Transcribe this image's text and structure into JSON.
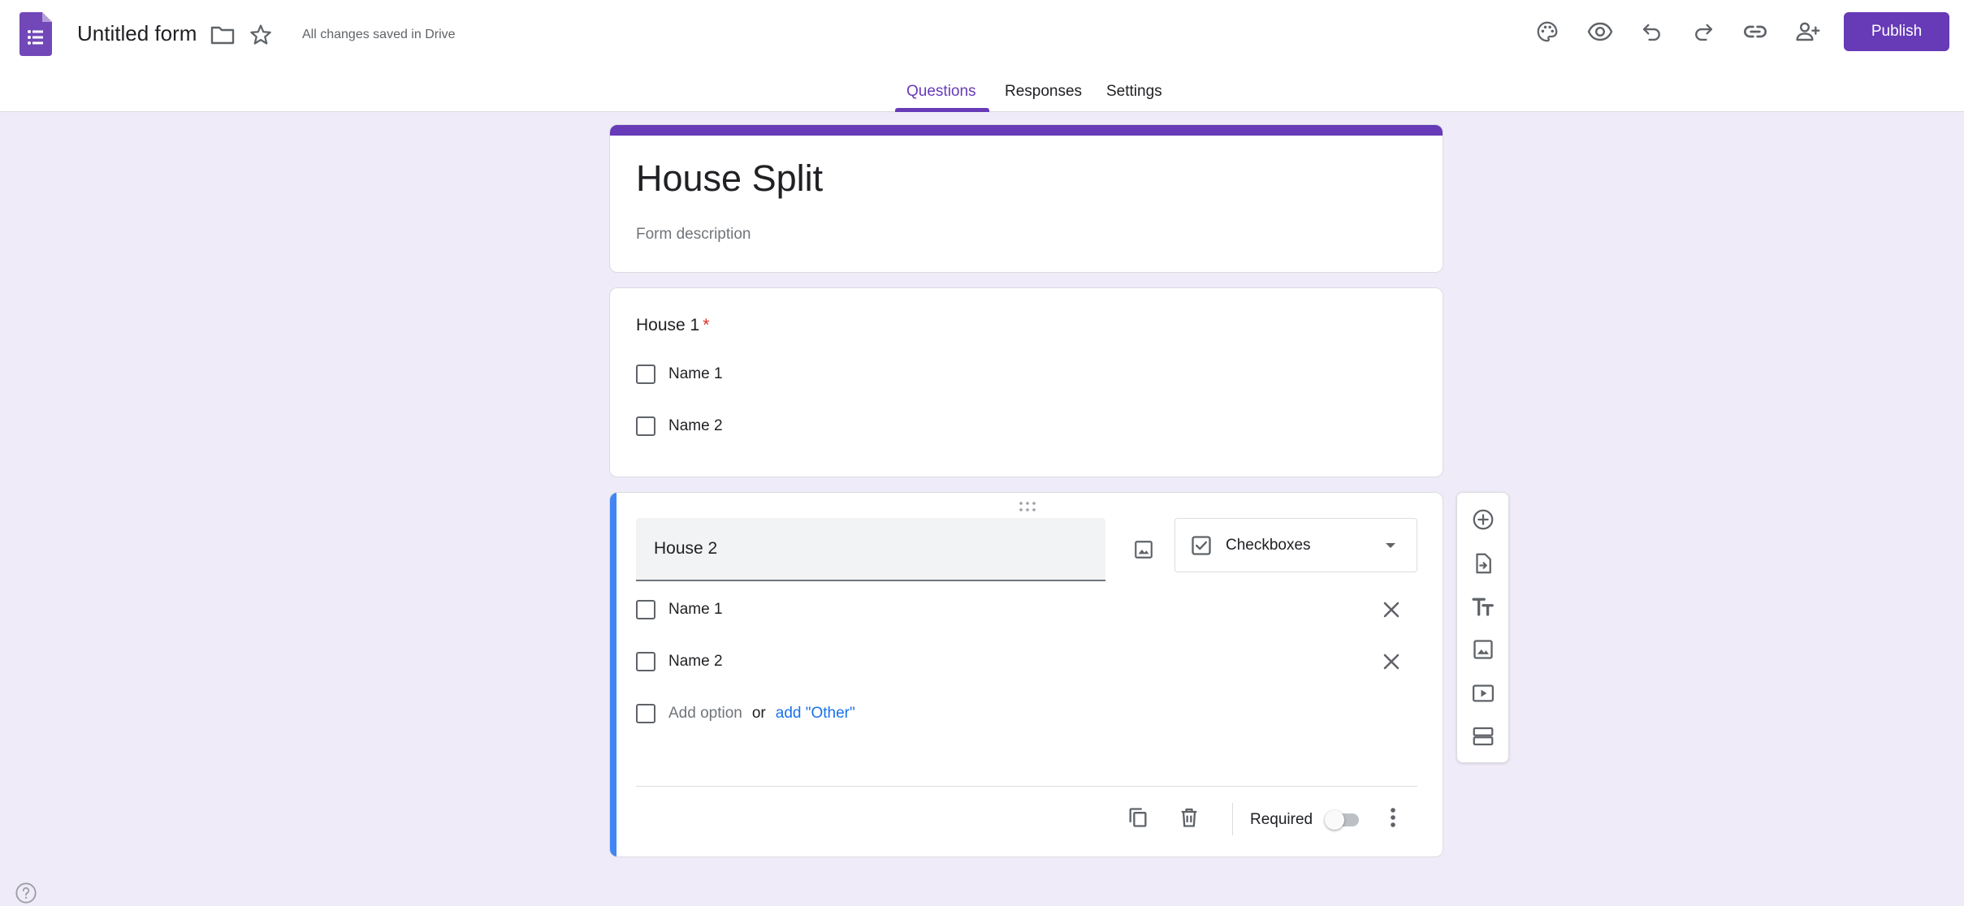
{
  "header": {
    "form_title": "Untitled form",
    "save_status": "All changes saved in Drive",
    "publish_label": "Publish",
    "icons": [
      "forms-logo-icon",
      "folder-icon",
      "star-icon",
      "palette-icon",
      "preview-eye-icon",
      "undo-icon",
      "redo-icon",
      "link-icon",
      "add-collaborator-icon"
    ]
  },
  "tabs": [
    "Questions",
    "Responses",
    "Settings"
  ],
  "active_tab": "Questions",
  "form": {
    "title": "House Split",
    "description_placeholder": "Form description"
  },
  "question1": {
    "title": "House 1",
    "required_marker": "*",
    "options": [
      "Name 1",
      "Name 2"
    ]
  },
  "question2": {
    "title": "House 2",
    "type": "Checkboxes",
    "options": [
      "Name 1",
      "Name 2"
    ],
    "add_option": "Add option",
    "or_text": "or",
    "add_other": "add \"Other\"",
    "required_label": "Required",
    "required_on": false
  },
  "toolbar_icons": [
    "add-question-icon",
    "import-questions-icon",
    "add-title-icon",
    "add-image-icon",
    "add-video-icon",
    "add-section-icon"
  ],
  "colors": {
    "accent": "#673ab7",
    "background": "#f0ebf8",
    "active_question": "#4285f4",
    "link": "#1a73e8",
    "required": "#d93025"
  }
}
